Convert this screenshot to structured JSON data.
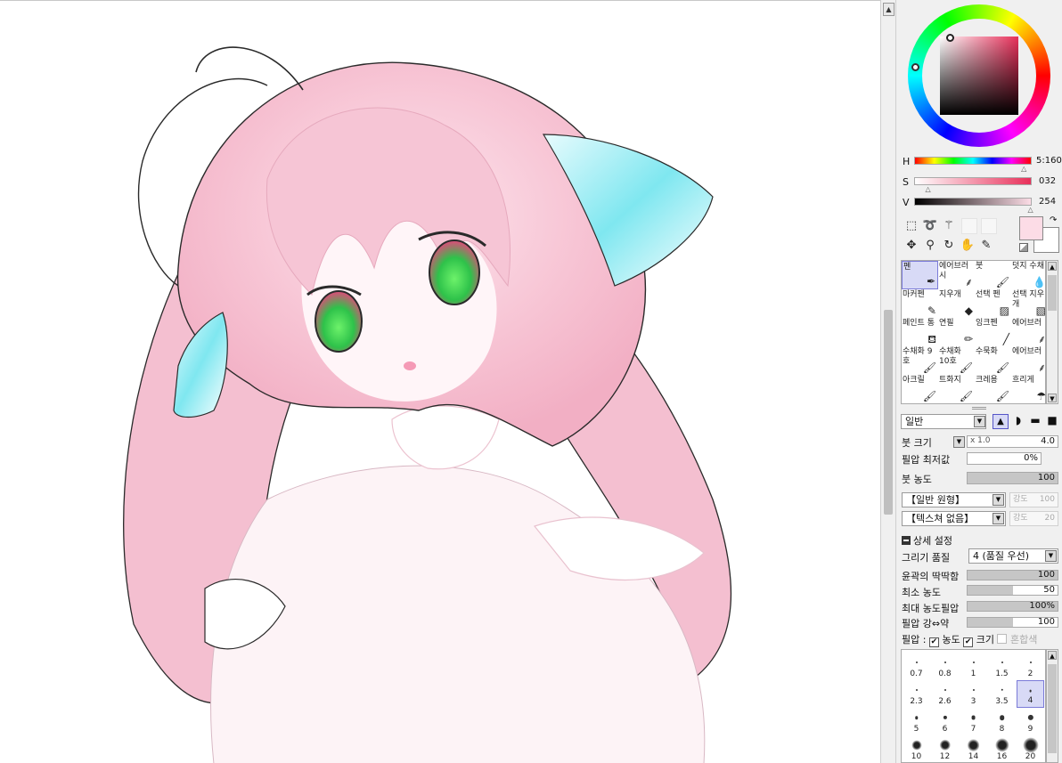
{
  "color": {
    "h_label": "H",
    "h_value": "5:160",
    "s_label": "S",
    "s_value": "032",
    "v_label": "V",
    "v_value": "254",
    "h_fraction": 0.94,
    "s_fraction": 0.125,
    "v_fraction": 0.996,
    "primary_hex": "#fcdce6",
    "secondary_hex": "#ffffff",
    "hue_square_hex": "#e8305a"
  },
  "tools": {
    "row1": [
      "select-rect-icon",
      "lasso-icon",
      "magic-wand-icon",
      "blank-slot-icon",
      "blank-slot-icon"
    ],
    "row2": [
      "move-icon",
      "zoom-icon",
      "rotate-icon",
      "hand-icon",
      "eyedropper-icon"
    ]
  },
  "brushes": [
    {
      "label": "펜",
      "icon": "pen-icon",
      "sel": true
    },
    {
      "label": "에어브러시",
      "icon": "airbrush-icon",
      "sel": false
    },
    {
      "label": "붓",
      "icon": "brush-icon",
      "sel": false
    },
    {
      "label": "덧지 수채",
      "icon": "watercolor-icon",
      "sel": false
    },
    {
      "label": "마커펜",
      "icon": "marker-icon",
      "sel": false
    },
    {
      "label": "지우개",
      "icon": "eraser-icon",
      "sel": false
    },
    {
      "label": "선택 펜",
      "icon": "select-pen-icon",
      "sel": false
    },
    {
      "label": "선택 지우개",
      "icon": "select-eraser-icon",
      "sel": false
    },
    {
      "label": "페인트 통",
      "icon": "bucket-icon",
      "sel": false
    },
    {
      "label": "연필",
      "icon": "pencil-icon",
      "sel": false
    },
    {
      "label": "잉크펜",
      "icon": "ink-pen-icon",
      "sel": false
    },
    {
      "label": "에어브러",
      "icon": "airbrush-icon",
      "sel": false
    },
    {
      "label": "수채화 9호",
      "icon": "brush-icon",
      "sel": false
    },
    {
      "label": "수채화 10호",
      "icon": "brush-icon",
      "sel": false
    },
    {
      "label": "수묵화",
      "icon": "brush-icon",
      "sel": false
    },
    {
      "label": "에어브러",
      "icon": "airbrush-icon",
      "sel": false
    },
    {
      "label": "아크릴",
      "icon": "brush-icon",
      "sel": false
    },
    {
      "label": "트화지",
      "icon": "brush-icon",
      "sel": false
    },
    {
      "label": "크레용",
      "icon": "brush-icon",
      "sel": false
    },
    {
      "label": "흐리게",
      "icon": "blur-icon",
      "sel": false
    }
  ],
  "blend_mode": "일반",
  "brush_size": {
    "label": "붓 크기",
    "multiplier": "x 1.0",
    "value": "4.0"
  },
  "min_size": {
    "label": "필압 최저값",
    "value": "0%",
    "fraction": 0
  },
  "density": {
    "label": "붓 농도",
    "value": "100",
    "fraction": 1
  },
  "shape_dropdown": "【일반 원형】",
  "shape_strength": "강도",
  "shape_strength_value": "100",
  "texture_dropdown": "【텍스쳐 없음】",
  "texture_strength": "강도",
  "texture_strength_value": "20",
  "advanced_title": "상세 설정",
  "quality": {
    "label": "그리기 품질",
    "value": "4 (품질 우선)"
  },
  "edge_hardness": {
    "label": "윤곽의 딱딱함",
    "value": "100",
    "fraction": 1
  },
  "min_density": {
    "label": "최소 농도",
    "value": "50",
    "fraction": 0.5
  },
  "max_density_pressure": {
    "label": "최대 농도필압",
    "value": "100%",
    "fraction": 1
  },
  "pressure_hardsoft": {
    "label": "필압 강⇔약",
    "value": "100",
    "fraction": 0.5
  },
  "pressure_row": {
    "label": "필압 :",
    "density": "농도",
    "size": "크기",
    "blend": "혼합색"
  },
  "sizes": [
    "0.7",
    "0.8",
    "1",
    "1.5",
    "2",
    "2.3",
    "2.6",
    "3",
    "3.5",
    "4",
    "5",
    "6",
    "7",
    "8",
    "9",
    "10",
    "12",
    "14",
    "16",
    "20"
  ],
  "selected_size_index": 9
}
